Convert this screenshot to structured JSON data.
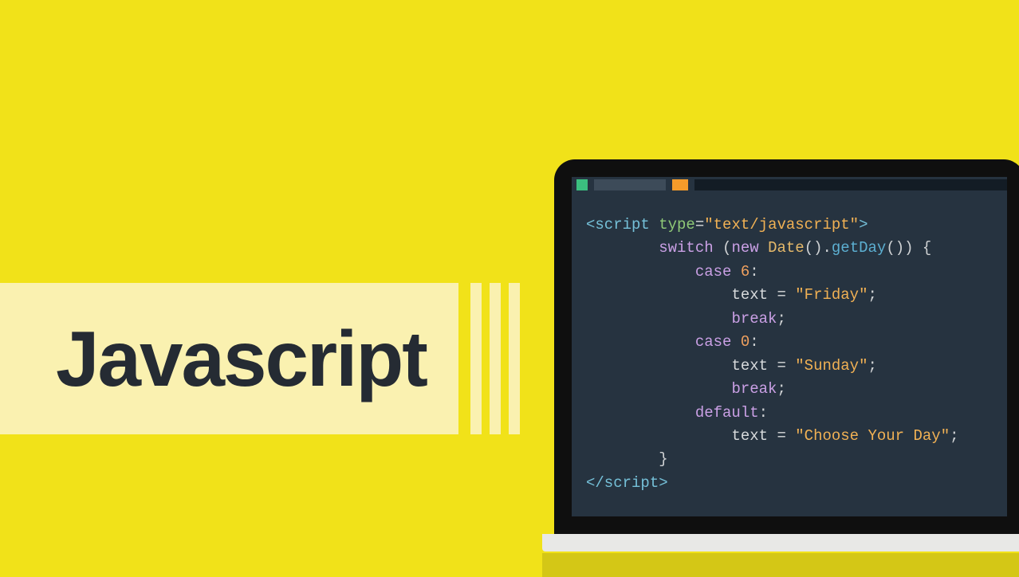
{
  "title": "Javascript",
  "code": {
    "line1": {
      "open": "<script",
      "attrName": " type",
      "eq": "=",
      "attrVal": "\"text/javascript\"",
      "close": ">"
    },
    "line2": {
      "kw": "switch",
      "p1": " (",
      "kw2": "new",
      "sp": " ",
      "type": "Date",
      "p2": "().",
      "fn": "getDay",
      "p3": "()) {"
    },
    "line3": {
      "kw": "case",
      "sp": " ",
      "num": "6",
      "colon": ":"
    },
    "line4": {
      "lhs": "text ",
      "eq": "=",
      "sp": " ",
      "str": "\"Friday\"",
      "semi": ";"
    },
    "line5": {
      "kw": "break",
      "semi": ";"
    },
    "line6": {
      "kw": "case",
      "sp": " ",
      "num": "0",
      "colon": ":"
    },
    "line7": {
      "lhs": "text ",
      "eq": "=",
      "sp": " ",
      "str": "\"Sunday\"",
      "semi": ";"
    },
    "line8": {
      "kw": "break",
      "semi": ";"
    },
    "line9": {
      "kw": "default",
      "colon": ":"
    },
    "line10": {
      "lhs": "text ",
      "eq": "=",
      "sp": " ",
      "str": "\"Choose Your Day\"",
      "semi": ";"
    },
    "line11": {
      "brace": "}"
    },
    "line12": {
      "close": "</script",
      "gt": ">"
    }
  }
}
